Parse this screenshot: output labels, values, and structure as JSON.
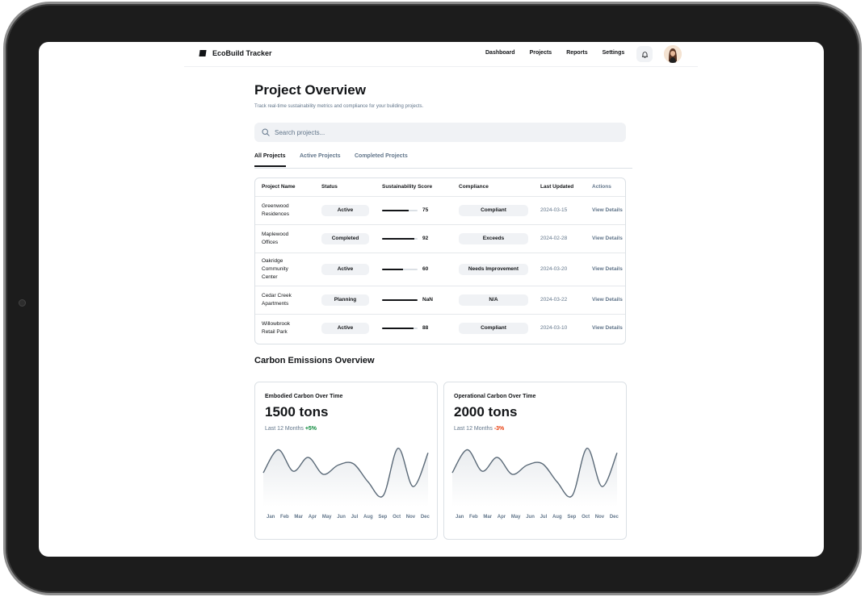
{
  "app": {
    "title": "EcoBuild Tracker"
  },
  "nav": {
    "links": [
      "Dashboard",
      "Projects",
      "Reports",
      "Settings"
    ]
  },
  "page": {
    "title": "Project Overview",
    "subtitle": "Track real-time sustainability metrics and compliance for your building projects."
  },
  "search": {
    "placeholder": "Search projects..."
  },
  "tabs": [
    "All Projects",
    "Active Projects",
    "Completed Projects"
  ],
  "table": {
    "headers": [
      "Project Name",
      "Status",
      "Sustainability Score",
      "Compliance",
      "Last Updated",
      "Actions"
    ],
    "rows": [
      {
        "name": "Greenwood Residences",
        "status": "Active",
        "score": 75,
        "score_label": "75",
        "compliance": "Compliant",
        "updated": "2024-03-15",
        "action": "View Details"
      },
      {
        "name": "Maplewood Offices",
        "status": "Completed",
        "score": 92,
        "score_label": "92",
        "compliance": "Exceeds",
        "updated": "2024-02-28",
        "action": "View Details"
      },
      {
        "name": "Oakridge Community Center",
        "status": "Active",
        "score": 60,
        "score_label": "60",
        "compliance": "Needs Improvement",
        "updated": "2024-03-20",
        "action": "View Details"
      },
      {
        "name": "Cedar Creek Apartments",
        "status": "Planning",
        "score": 100,
        "score_label": "NaN",
        "compliance": "N/A",
        "updated": "2024-03-22",
        "action": "View Details"
      },
      {
        "name": "Willowbrook Retail Park",
        "status": "Active",
        "score": 88,
        "score_label": "88",
        "compliance": "Compliant",
        "updated": "2024-03-10",
        "action": "View Details"
      }
    ]
  },
  "emissions": {
    "section_title": "Carbon Emissions Overview",
    "cards": [
      {
        "title": "Embodied Carbon Over Time",
        "value": "1500 tons",
        "period": "Last 12 Months",
        "change": "+5%"
      },
      {
        "title": "Operational Carbon Over Time",
        "value": "2000 tons",
        "period": "Last 12 Months",
        "change": "-3%"
      }
    ]
  },
  "chart_data": [
    {
      "type": "area",
      "title": "Embodied Carbon Over Time",
      "x": [
        "Jan",
        "Feb",
        "Mar",
        "Apr",
        "May",
        "Jun",
        "Jul",
        "Aug",
        "Sep",
        "Oct",
        "Nov",
        "Dec"
      ],
      "values": [
        40,
        70,
        42,
        60,
        38,
        50,
        52,
        28,
        10,
        72,
        22,
        66
      ],
      "grid": false
    },
    {
      "type": "area",
      "title": "Operational Carbon Over Time",
      "x": [
        "Jan",
        "Feb",
        "Mar",
        "Apr",
        "May",
        "Jun",
        "Jul",
        "Aug",
        "Sep",
        "Oct",
        "Nov",
        "Dec"
      ],
      "values": [
        40,
        70,
        42,
        60,
        38,
        50,
        52,
        28,
        10,
        72,
        22,
        66
      ],
      "grid": false
    }
  ],
  "colors": {
    "accent": "#121417",
    "muted": "#61758a",
    "positive": "#088738",
    "negative": "#e73908",
    "pill": "#f0f2f5"
  }
}
